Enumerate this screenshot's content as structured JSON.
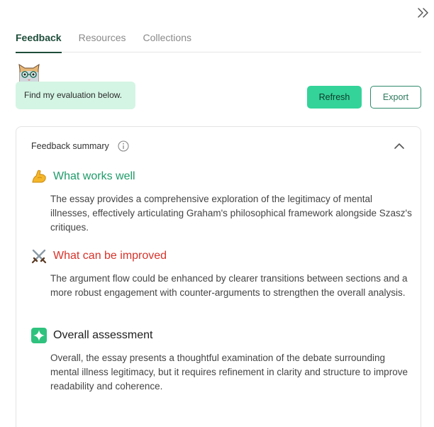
{
  "tabs": [
    {
      "label": "Feedback",
      "active": true
    },
    {
      "label": "Resources",
      "active": false
    },
    {
      "label": "Collections",
      "active": false
    }
  ],
  "assistant": {
    "message": "Find my evaluation below.",
    "mascot_icon": "cat-mascot-icon"
  },
  "actions": {
    "refresh_label": "Refresh",
    "export_label": "Export"
  },
  "summary": {
    "title": "Feedback summary",
    "sections": [
      {
        "icon": "flexed-biceps-icon",
        "title": "What works well",
        "body": "The essay provides a comprehensive exploration of the legitimacy of mental illnesses, effectively articulating Graham's philosophical framework alongside Szasz's critiques."
      },
      {
        "icon": "crossed-swords-icon",
        "title": "What can be improved",
        "body": "The argument flow could be enhanced by clearer transitions between sections and a more robust engagement with counter-arguments to strengthen the overall analysis."
      },
      {
        "icon": "sparkle-icon",
        "title": "Overall assessment",
        "body": "Overall, the essay presents a thoughtful examination of the debate surrounding mental illness legitimacy, but it requires refinement in clarity and structure to improve readability and coherence."
      }
    ]
  },
  "colors": {
    "accent": "#34d39a",
    "bubble": "#d4f5e4",
    "positive": "#1f9b6a",
    "negative": "#d6332b",
    "tab_active": "#1e4d3a"
  }
}
